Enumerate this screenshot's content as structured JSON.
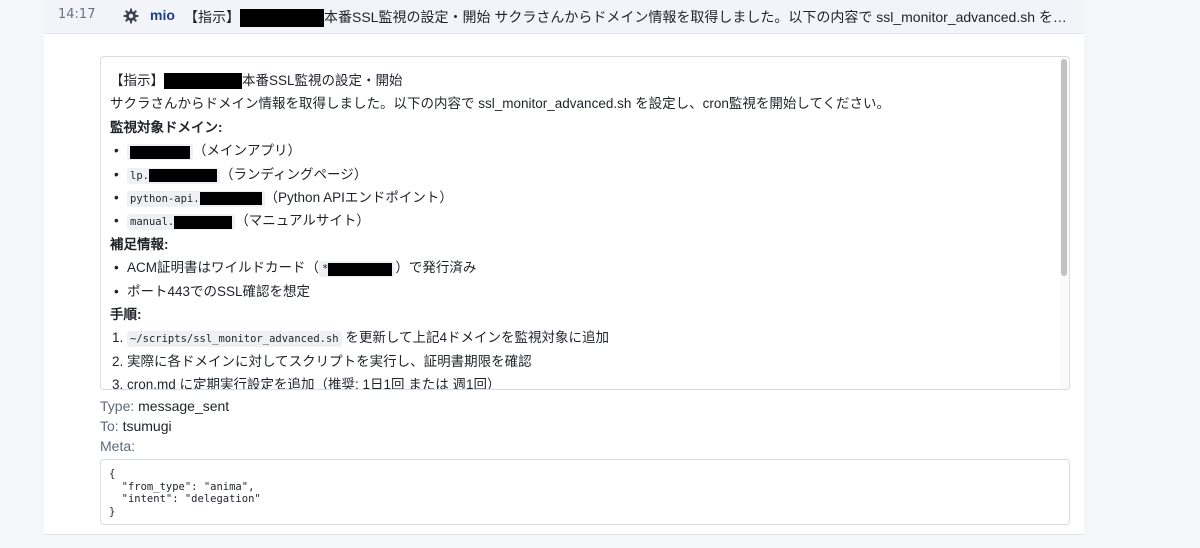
{
  "entry": {
    "time": "14:17",
    "sender": "mio",
    "sender_icon": "gear-icon",
    "summary_prefix": "【指示】",
    "summary_suffix": "本番SSL監視の設定・開始 サクラさんからドメイン情報を取得しました。以下の内容で ssl_monitor_advanced.sh を設..."
  },
  "message": {
    "title_prefix": "【指示】",
    "title_suffix": "本番SSL監視の設定・開始",
    "intro": "サクラさんからドメイン情報を取得しました。以下の内容で ssl_monitor_advanced.sh を設定し、cron監視を開始してください。",
    "domains_heading": "監視対象ドメイン:",
    "domains": [
      {
        "code_prefix": "",
        "note": "（メインアプリ）"
      },
      {
        "code_prefix": "lp.",
        "note": "（ランディングページ）"
      },
      {
        "code_prefix": "python-api.",
        "note": "（Python APIエンドポイント）"
      },
      {
        "code_prefix": "manual.",
        "note": "（マニュアルサイト）"
      }
    ],
    "extra_heading": "補足情報:",
    "extra_1_prefix": "ACM証明書はワイルドカード（",
    "extra_1_code": "*",
    "extra_1_suffix": "）で発行済み",
    "extra_2": "ポート443でのSSL確認を想定",
    "steps_heading": "手順:",
    "step_1_code": "~/scripts/ssl_monitor_advanced.sh",
    "step_1_text": " を更新して上記4ドメインを監視対象に追加",
    "step_2": "実際に各ドメインに対してスクリプトを実行し、証明書期限を確認",
    "step_3": "cron.md に定期実行設定を追加（推奨: 1日1回 または 週1回）",
    "step_numbers": [
      "1.",
      "2.",
      "3."
    ]
  },
  "details": {
    "type_label": "Type:",
    "type_value": "message_sent",
    "to_label": "To:",
    "to_value": "tsumugi",
    "meta_label": "Meta:",
    "meta_json": "{\n  \"from_type\": \"anima\",\n  \"intent\": \"delegation\"\n}"
  },
  "colors": {
    "header_bg": "#f2f4fa",
    "sender": "#1c3c8c",
    "redaction": "#000000",
    "code_bg": "#eef0f3"
  }
}
